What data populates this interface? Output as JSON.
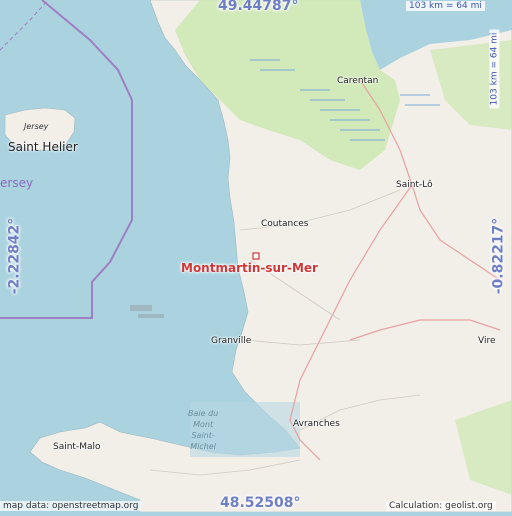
{
  "map": {
    "place_name": "Montmartin-sur-Mer",
    "coords": {
      "top": "49.44787°",
      "bottom": "48.52508°",
      "left": "-2.22842°",
      "right": "-0.82217°"
    },
    "scale_top": "103 km = 64 mi",
    "scale_right": "103 km = 64 mi",
    "towns": {
      "carentan": "Carentan",
      "saint_lo": "Saint-Lô",
      "coutances": "Coutances",
      "granville": "Granville",
      "vire": "Vire",
      "avranches": "Avranches",
      "saint_malo": "Saint-Malo",
      "saint_helier": "Saint Helier",
      "jersey_small": "Jersey",
      "jersey_big": "ersey"
    },
    "bay_lines": [
      "Baie du",
      "Mont",
      "Saint-",
      "Michel"
    ],
    "attribution_left": "map data: openstreetmap.org",
    "attribution_right": "Calculation: geolist.org",
    "colors": {
      "sea": "#aad3df",
      "land": "#f2efe9",
      "green": "#cde8b0",
      "border": "#9f7fc4",
      "place": "#d03838",
      "coord": "#6f7fc5"
    }
  }
}
